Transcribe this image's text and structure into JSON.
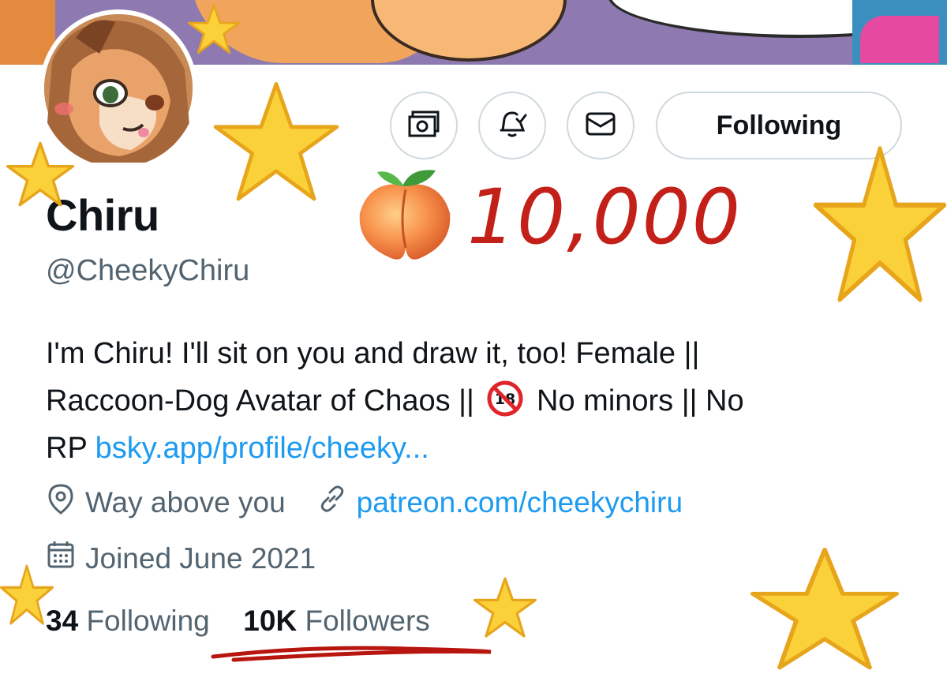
{
  "profile": {
    "display_name": "Chiru",
    "handle": "@CheekyChiru",
    "bio": {
      "line1": "I'm Chiru! I'll sit on you and draw it, too! Female ||",
      "line2_a": "Raccoon-Dog Avatar of Chaos ||",
      "line2_b": "No minors || No",
      "line3_a": "RP",
      "line3_link": "bsky.app/profile/cheeky..."
    },
    "location": "Way above you",
    "website": "patreon.com/cheekychiru",
    "joined": "Joined June 2021",
    "following_count": "34",
    "following_label": "Following",
    "followers_count": "10K",
    "followers_label": "Followers"
  },
  "actions": {
    "following_button": "Following",
    "icons": [
      "money-icon",
      "bell-check-icon",
      "mail-icon"
    ]
  },
  "overlay": {
    "counter": "10,000",
    "emoji": "peach"
  },
  "colors": {
    "link": "#1d9bf0",
    "secondary_text": "#536471",
    "counter_red": "#c4201a",
    "banner_purple": "#8e7ab0"
  }
}
